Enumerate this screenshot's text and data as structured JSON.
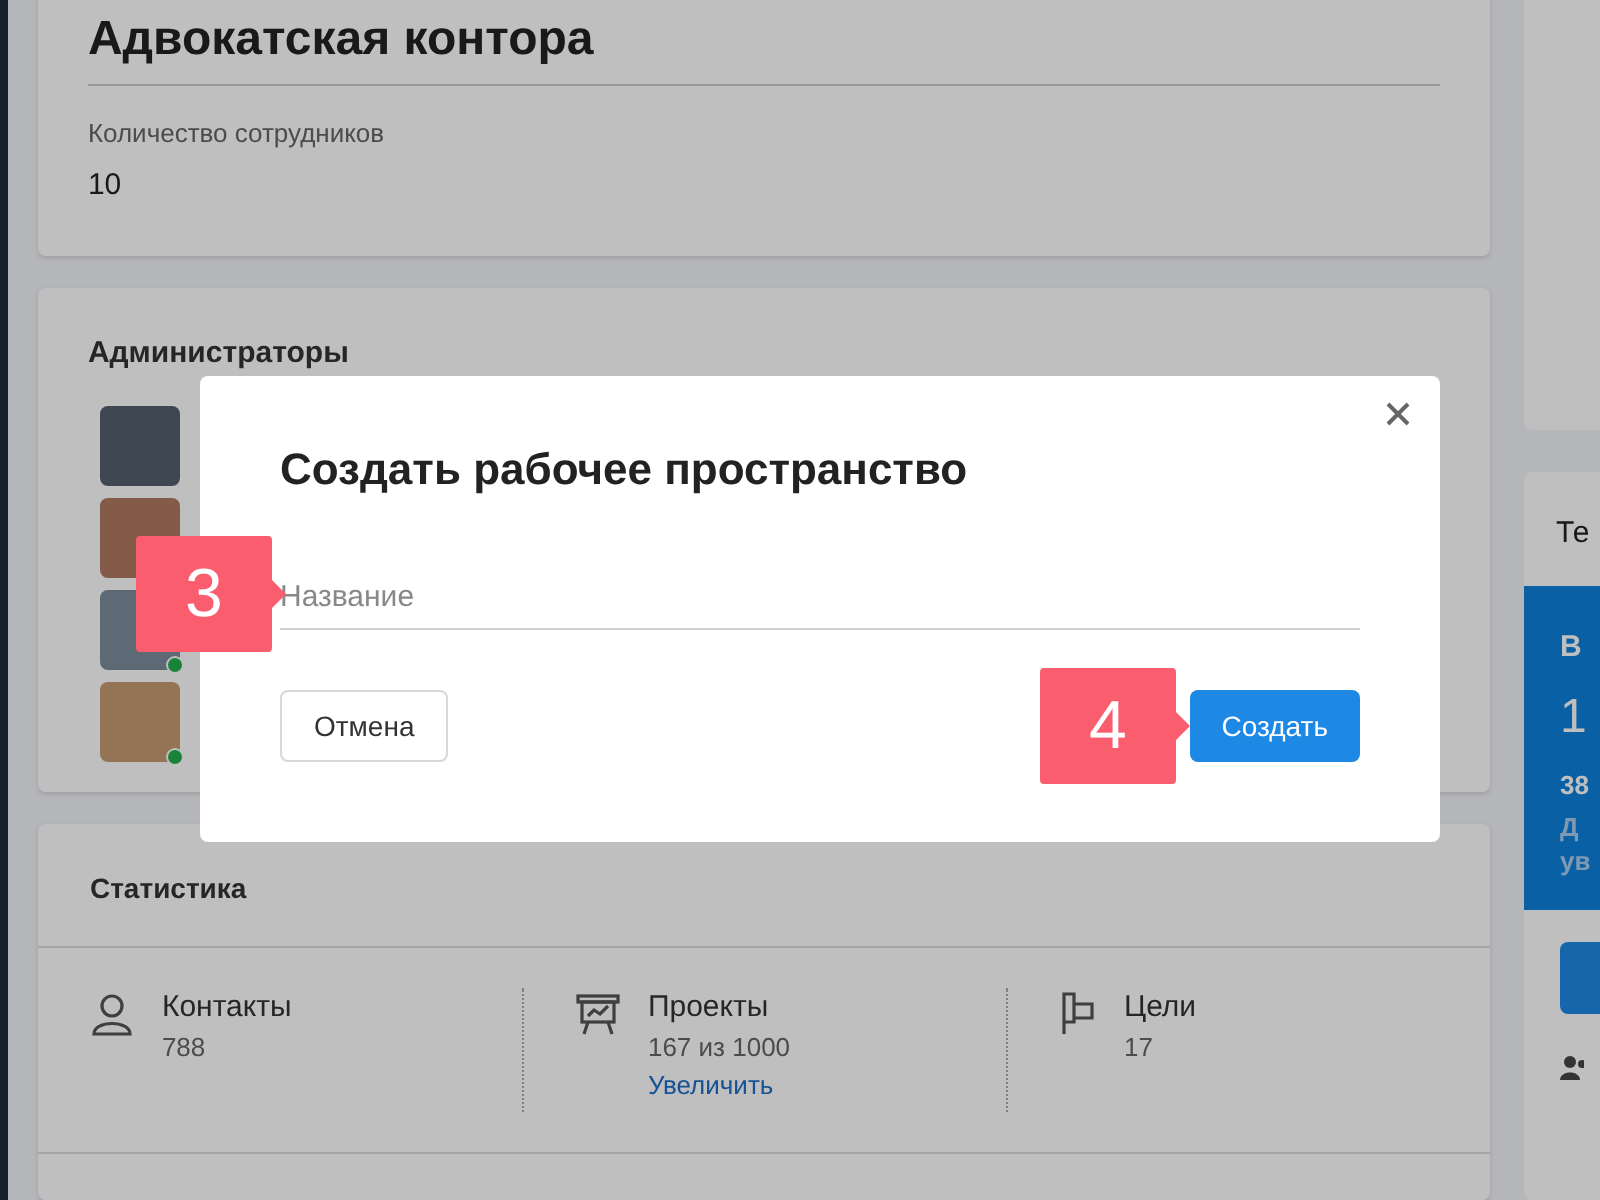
{
  "company": {
    "title": "Адвокатская контора",
    "employees_label": "Количество сотрудников",
    "employees_value": "10"
  },
  "admins": {
    "title": "Администраторы",
    "members": [
      {
        "online": false
      },
      {
        "online": false
      },
      {
        "online": true
      },
      {
        "online": true
      }
    ]
  },
  "statistics": {
    "title": "Статистика",
    "items": [
      {
        "kind": "contacts",
        "label": "Контакты",
        "value": "788"
      },
      {
        "kind": "projects",
        "label": "Проекты",
        "value": "167 из 1000",
        "link": "Увеличить"
      },
      {
        "kind": "goals",
        "label": "Цели",
        "value": "17"
      }
    ]
  },
  "right_panel": {
    "card_title": "Те",
    "promo_heading": "В",
    "promo_number": "1",
    "promo_sub": "38",
    "promo_text": [
      "Д",
      "ув"
    ]
  },
  "dialog": {
    "title": "Создать рабочее пространство",
    "name_field": {
      "placeholder": "Название"
    },
    "cancel_button": "Отмена",
    "create_button": "Создать"
  },
  "callouts": [
    {
      "number": "3"
    },
    {
      "number": "4"
    }
  ]
}
